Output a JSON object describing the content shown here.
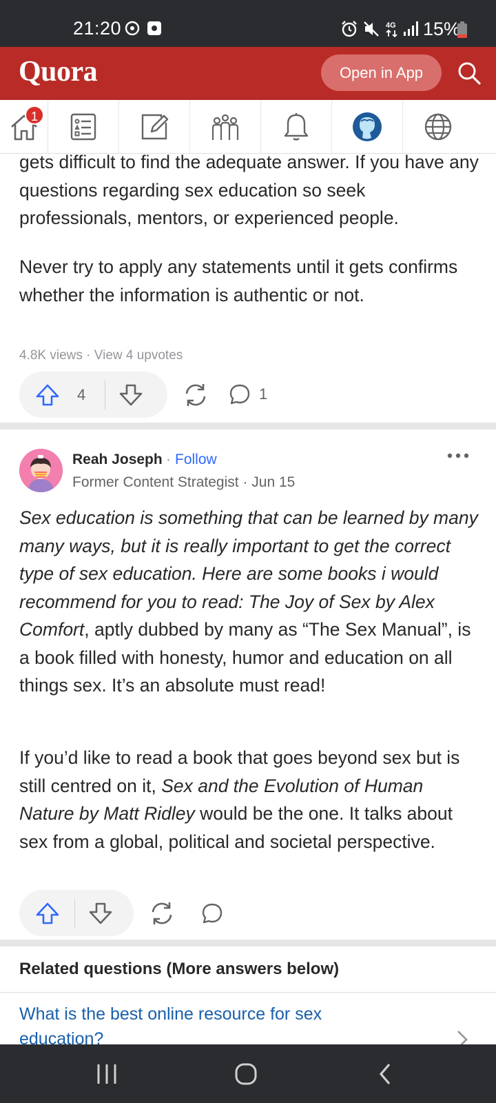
{
  "status_bar": {
    "time": "21:20",
    "battery": "15%",
    "icons": [
      "sync-icon",
      "screenshot-icon",
      "alarm-icon",
      "mute-icon",
      "4g-icon",
      "signal-icon",
      "battery-icon"
    ]
  },
  "header": {
    "logo": "Quora",
    "open_app": "Open in App",
    "brand_color": "#b92b27"
  },
  "nav": {
    "home_badge": "1",
    "tabs": [
      "home-icon",
      "following-icon",
      "answer-icon",
      "spaces-icon",
      "notifications-icon",
      "profile-icon",
      "languages-icon"
    ]
  },
  "answer1": {
    "para1": "gets difficult to find the adequate answer. If you have any questions regarding sex education so seek professionals, mentors, or experienced people.",
    "para2": "Never try to apply any statements until it gets confirms whether the information is authentic or not.",
    "views": "4.8K views",
    "view_upvotes": "View 4 upvotes",
    "upvotes": "4",
    "comments": "1"
  },
  "answer2": {
    "author": "Reah Joseph",
    "follow": "Follow",
    "credential": "Former Content Strategist",
    "date": "Jun 15",
    "p1_italic": "Sex education is something that can be learned by many many ways, but it is really important to get the correct type of sex education. Here are some books i would recommend for you to read: The Joy of Sex by Alex Comfort",
    "p1_rest": ", aptly dubbed by many as “The Sex Manual”, is a book filled with honesty, humor and education on all things sex. It’s an absolute must read!",
    "p2_start": "If you’d like to read a book that goes beyond sex but is still centred on it, ",
    "p2_italic": "Sex and the Evolution of Human Nature by Matt Ridley",
    "p2_rest": " would be the one. It talks about sex from a global, political and societal perspective."
  },
  "related": {
    "title": "Related questions (More answers below)",
    "question": "What is the best online resource for sex education?"
  }
}
